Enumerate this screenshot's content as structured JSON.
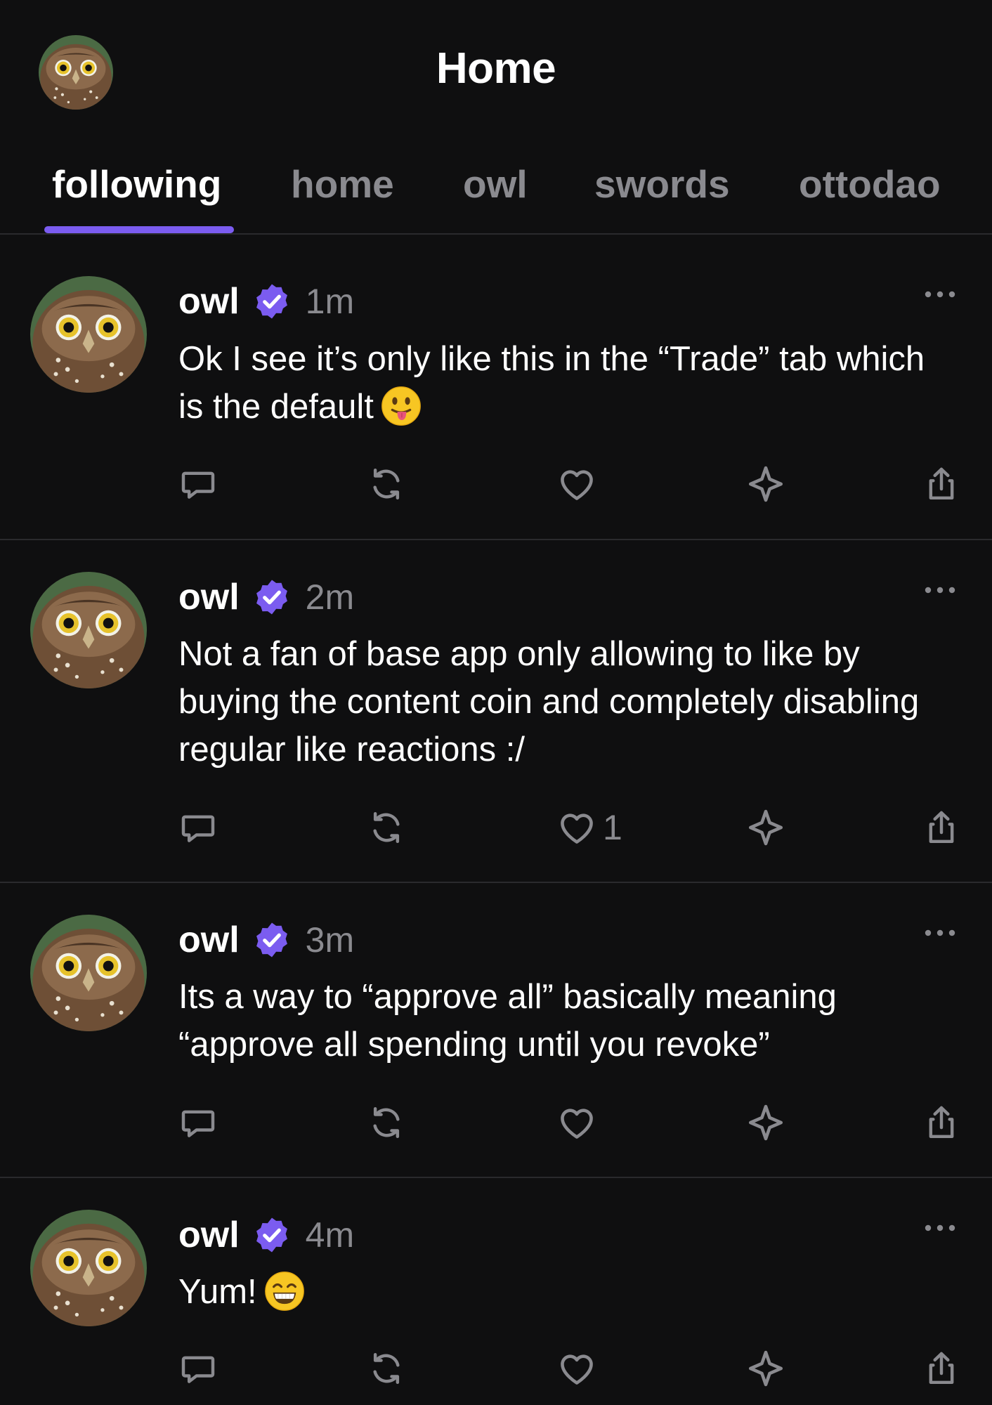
{
  "header": {
    "title": "Home"
  },
  "tabs": [
    {
      "label": "following",
      "active": true
    },
    {
      "label": "home",
      "active": false
    },
    {
      "label": "owl",
      "active": false
    },
    {
      "label": "swords",
      "active": false
    },
    {
      "label": "ottodao",
      "active": false
    }
  ],
  "colors": {
    "background": "#0f0f10",
    "accent": "#7b5cf0",
    "muted": "#8a8a8f",
    "divider": "#2a2a2d"
  },
  "posts": [
    {
      "author": "owl",
      "verified": true,
      "time": "1m",
      "text": "Ok I see it’s only like this in the “Trade” tab which is the default",
      "emoji": "tongue-face-icon",
      "like_count": ""
    },
    {
      "author": "owl",
      "verified": true,
      "time": "2m",
      "text": "Not a fan of base app only allowing to like by buying the content coin and completely disabling regular like reactions :/",
      "emoji": "",
      "like_count": "1"
    },
    {
      "author": "owl",
      "verified": true,
      "time": "3m",
      "text": "Its a way to “approve all” basically meaning “approve all spending until you revoke”",
      "emoji": "",
      "like_count": ""
    },
    {
      "author": "owl",
      "verified": true,
      "time": "4m",
      "text": "Yum!",
      "emoji": "grinning-face-icon",
      "like_count": ""
    }
  ],
  "icons": {
    "reply": "reply-icon",
    "recast": "recast-icon",
    "like": "heart-icon",
    "tip": "sparkle-icon",
    "share": "share-icon",
    "more": "more-icon",
    "verified": "verified-badge-icon"
  }
}
